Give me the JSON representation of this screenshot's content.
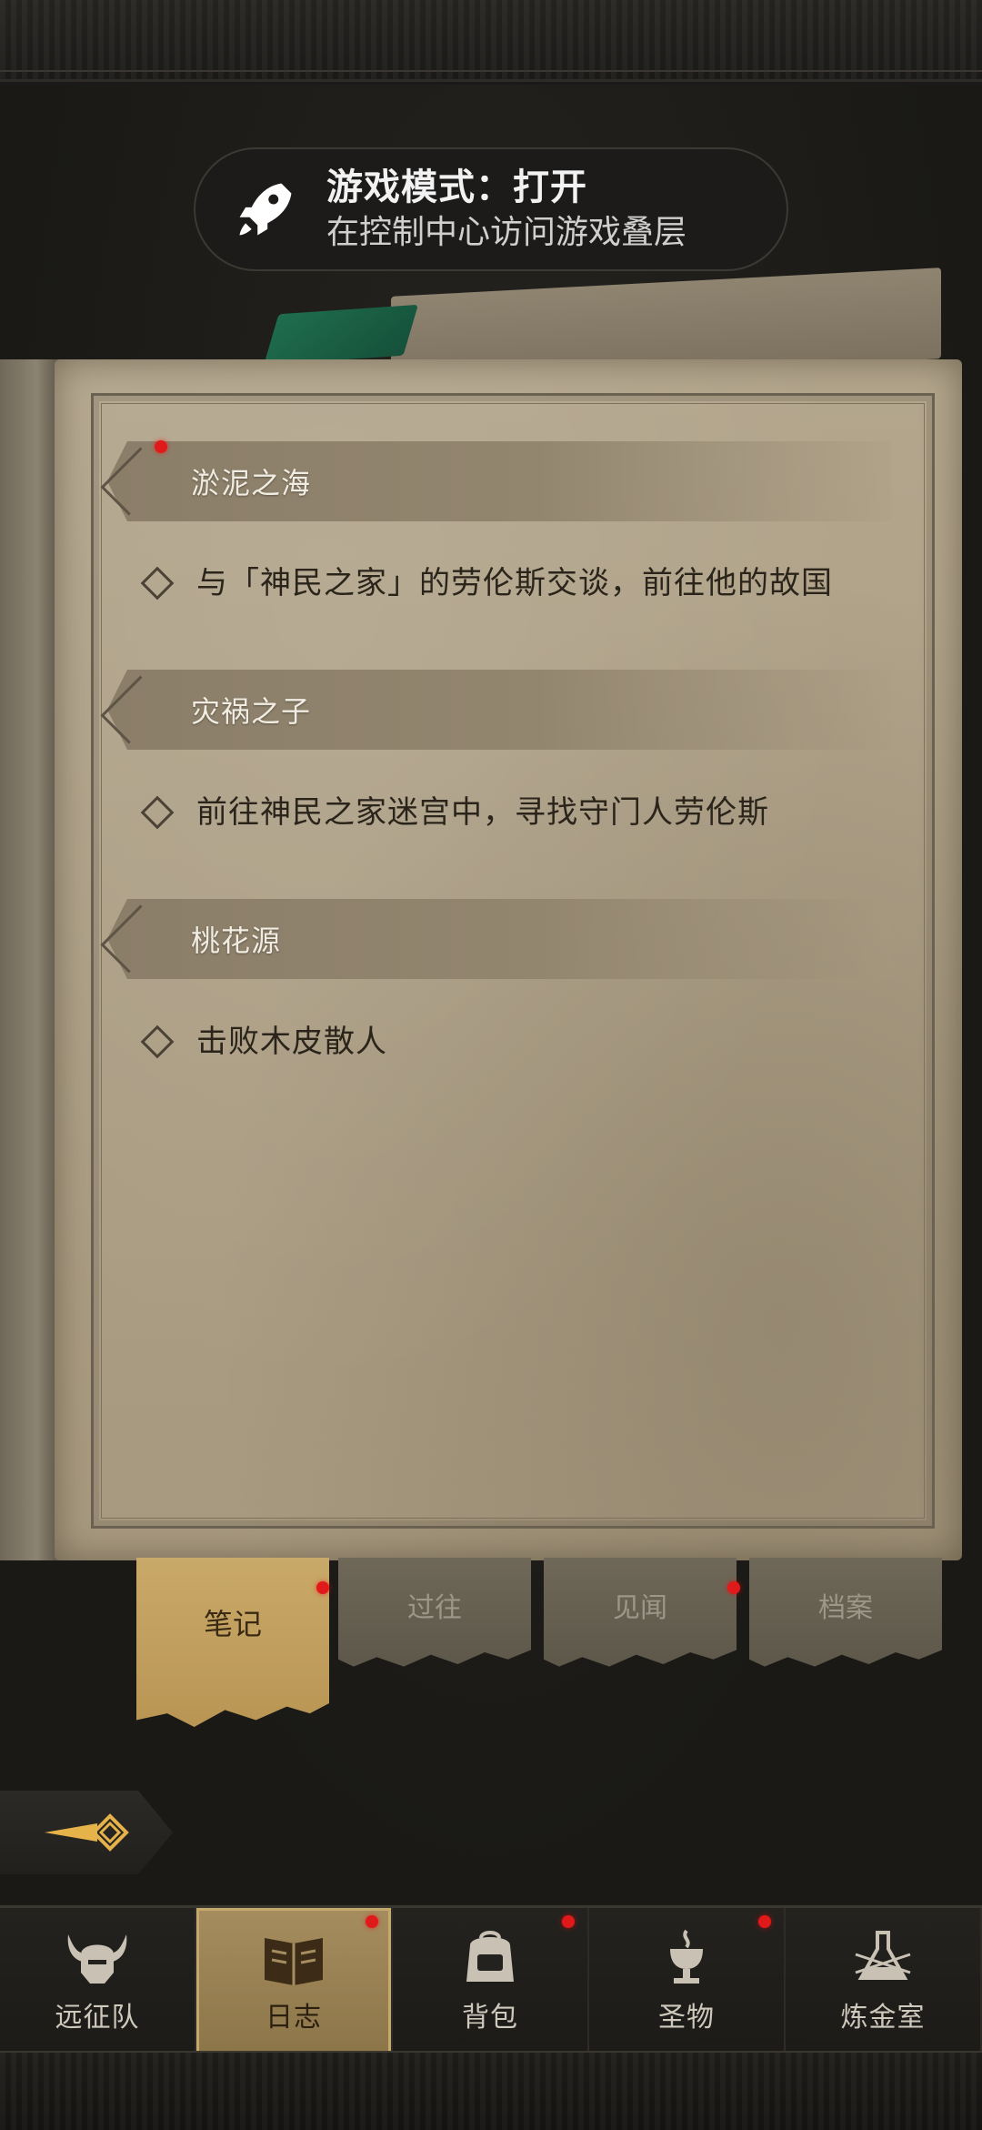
{
  "toast": {
    "title": "游戏模式：打开",
    "subtitle": "在控制中心访问游戏叠层",
    "icon": "rocket-icon"
  },
  "journal": {
    "sections": [
      {
        "title": "淤泥之海",
        "has_alert": true,
        "quests": [
          "与「神民之家」的劳伦斯交谈，前往他的故国"
        ]
      },
      {
        "title": "灾祸之子",
        "has_alert": false,
        "quests": [
          "前往神民之家迷宫中，寻找守门人劳伦斯"
        ]
      },
      {
        "title": "桃花源",
        "has_alert": false,
        "quests": [
          "击败木皮散人"
        ]
      }
    ]
  },
  "tabs": [
    {
      "label": "笔记",
      "active": true,
      "has_alert": true
    },
    {
      "label": "过往",
      "active": false,
      "has_alert": false
    },
    {
      "label": "见闻",
      "active": false,
      "has_alert": true
    },
    {
      "label": "档案",
      "active": false,
      "has_alert": false
    }
  ],
  "back_button": {
    "icon": "back-arrow-icon"
  },
  "bottom_nav": [
    {
      "label": "远征队",
      "icon": "horned-helmet-icon",
      "active": false,
      "has_alert": false
    },
    {
      "label": "日志",
      "icon": "journal-book-icon",
      "active": true,
      "has_alert": true
    },
    {
      "label": "背包",
      "icon": "backpack-icon",
      "active": false,
      "has_alert": true
    },
    {
      "label": "圣物",
      "icon": "relic-chalice-icon",
      "active": false,
      "has_alert": true
    },
    {
      "label": "炼金室",
      "icon": "alchemy-icon",
      "active": false,
      "has_alert": false
    }
  ],
  "colors": {
    "alert": "#e01a1a",
    "parchment": "#aea186",
    "active_tab": "#c9a969",
    "background": "#1b1a18"
  }
}
